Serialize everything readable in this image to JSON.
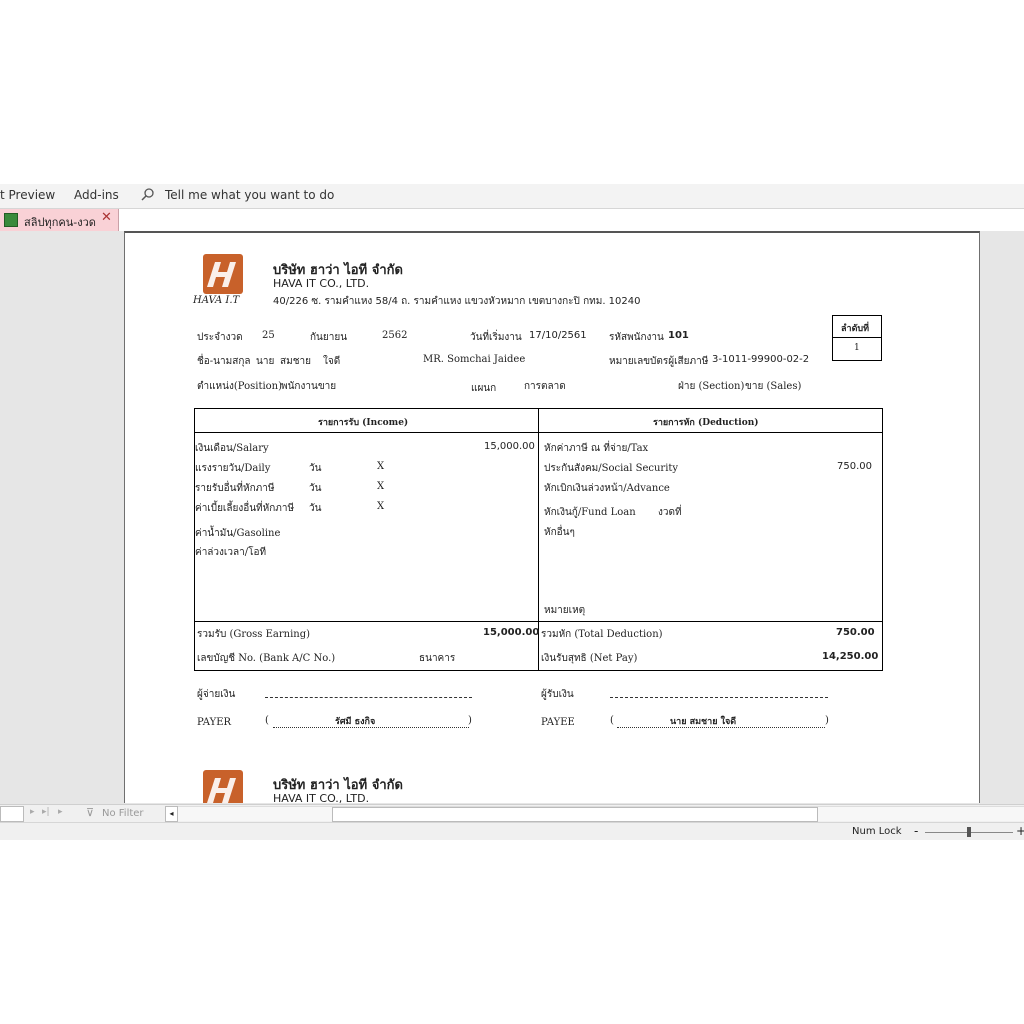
{
  "ribbon": {
    "tab_print_preview": "t Preview",
    "tab_addins": "Add-ins",
    "tell_me": "Tell me what you want to do"
  },
  "doc_tab": {
    "label": "สลิปทุกคน-งวด"
  },
  "slip": {
    "company_th": "บริษัท ฮาว่า ไอที จำกัด",
    "company_en": "HAVA IT CO., LTD.",
    "address": "40/226 ซ. รามคำแหง 58/4 ถ. รามคำแหง แขวงหัวหมาก เขตบางกะปิ กทม. 10240",
    "logo_text": "HAVA I.T",
    "seq_label": "ลำดับที่",
    "seq_value": "1",
    "period_label": "ประจำงวด",
    "period_day": "25",
    "period_month": "กันยายน",
    "period_year": "2562",
    "start_label": "วันที่เริ่มงาน",
    "start_value": "17/10/2561",
    "emp_code_label": "รหัสพนักงาน",
    "emp_code_value": "101",
    "name_label": "ชื่อ-นามสกุล",
    "name_th_prefix": "นาย",
    "name_th_first": "สมชาย",
    "name_th_last": "ใจดี",
    "name_en": "MR.  Somchai   Jaidee",
    "taxid_label": "หมายเลขบัตรผู้เสียภาษี",
    "taxid_value": "3-1011-99900-02-2",
    "position_label": "ตำแหน่ง(Position)",
    "position_value": "พนักงานขาย",
    "dept_label": "แผนก",
    "dept_value": "การตลาด",
    "section_label": "ฝ่าย (Section)",
    "section_value": "ขาย (Sales)",
    "income_header": "รายการรับ  (Income)",
    "deduction_header": "รายการหัก   (Deduction)",
    "income": {
      "salary_label": "เงินเดือน/Salary",
      "salary_value": "15,000.00",
      "daily_label": "แรงรายวัน/Daily",
      "other_taxable_label": "รายรับอื่นที่หักภาษี",
      "allowance_label": "ค่าเบี้ยเลี้ยงอื่นที่หักภาษี",
      "day_unit": "วัน",
      "x_mark": "X",
      "gasoline_label": "ค่าน้ำมัน/Gasoline",
      "ot_label": "ค่าล่วงเวลา/โอที"
    },
    "deduction": {
      "tax_label": "หักค่าภาษี ณ ที่จ่าย/Tax",
      "social_label": "ประกันสังคม/Social Security",
      "social_value": "750.00",
      "advance_label": "หักเบิกเงินล่วงหน้า/Advance",
      "fund_label": "หักเงินกู้/Fund Loan",
      "installment_label": "งวดที่",
      "other_label": "หักอื่นๆ",
      "remark_label": "หมายเหตุ"
    },
    "gross_label": "รวมรับ  (Gross Earning)",
    "gross_value": "15,000.00",
    "total_deduction_label": "รวมหัก  (Total Deduction)",
    "total_deduction_value": "750.00",
    "bank_label": "เลขบัญชี No. (Bank A/C  No.)",
    "bank_name_label": "ธนาคาร",
    "net_label": "เงินรับสุทธิ (Net Pay)",
    "net_value": "14,250.00",
    "payer_th": "ผู้จ่ายเงิน",
    "payer_en": "PAYER",
    "payer_name": "รัศมี ธงกิจ",
    "payee_th": "ผู้รับเงิน",
    "payee_en": "PAYEE",
    "payee_name": "นาย  สมชาย   ใจดี"
  },
  "navbar": {
    "filter_label": "No Filter"
  },
  "statusbar": {
    "num_lock": "Num Lock",
    "zoom_minus": "-",
    "zoom_plus": "+"
  },
  "colors": {
    "logo": "#c8612a",
    "doc_tab": "#f9d1d6",
    "ribbon": "#f3f3f3"
  }
}
